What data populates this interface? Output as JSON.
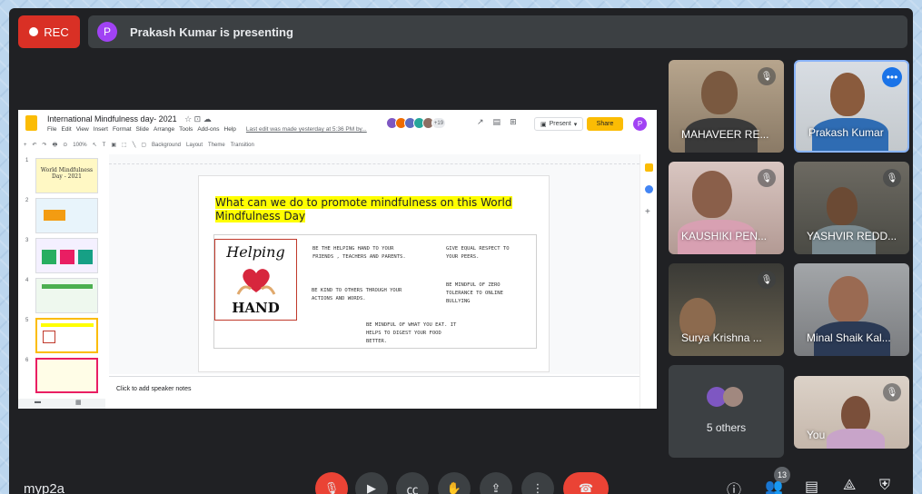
{
  "recording": {
    "label": "REC"
  },
  "presenter": {
    "avatar_letter": "P",
    "banner": "Prakash Kumar is presenting"
  },
  "slides_app": {
    "doc_title": "International Mindfulness day- 2021",
    "title_icons": "☆ ⊡ ☁",
    "menu": [
      "File",
      "Edit",
      "View",
      "Insert",
      "Format",
      "Slide",
      "Arrange",
      "Tools",
      "Add-ons",
      "Help"
    ],
    "last_edit": "Last edit was made yesterday at 5:36 PM by...",
    "collab_count": "+19",
    "present_label": "Present",
    "share_label": "Share",
    "user_letter": "P",
    "toolbar": [
      "+",
      "↶",
      "↷",
      "🖶",
      "⊙",
      "100%",
      "↖",
      "T",
      "▣",
      "⬚",
      "╲",
      "▢",
      "Background",
      "Layout",
      "Theme",
      "Transition"
    ],
    "thumbnails": [
      {
        "num": "1",
        "title": "World Mindfulness Day - 2021"
      },
      {
        "num": "2",
        "title": ""
      },
      {
        "num": "3",
        "title": ""
      },
      {
        "num": "4",
        "title": ""
      },
      {
        "num": "5",
        "title": ""
      },
      {
        "num": "6",
        "title": ""
      }
    ],
    "speaker_notes": "Click to add speaker notes",
    "current_slide": {
      "title": "What can we do to promote mindfulness on this World Mindfulness Day",
      "image_top": "Helping",
      "image_bottom": "HAND",
      "notes": [
        "Be the helping hand to your friends , teachers and parents.",
        "Give equal respect to your peers.",
        "Be kind to others through your actions and words.",
        "Be mindful of zero tolerance to online bullying",
        "Be mindful of what you eat. It helps to digest your food better."
      ]
    }
  },
  "participants": [
    {
      "name": "MAHAVEER RE...",
      "muted": true
    },
    {
      "name": "Prakash Kumar",
      "muted": false,
      "active": true
    },
    {
      "name": "KAUSHIKI PEN...",
      "muted": true
    },
    {
      "name": "YASHVIR REDD...",
      "muted": true
    },
    {
      "name": "Surya Krishna ...",
      "muted": true
    },
    {
      "name": "Minal Shaik Kal...",
      "muted": false
    },
    {
      "name": "5 others",
      "muted": false
    },
    {
      "name": "You",
      "muted": true
    }
  ],
  "bottom_bar": {
    "meeting_code": "myp2a",
    "people_count": "13"
  },
  "colors": {
    "rec": "#d93025",
    "end_call": "#ea4335",
    "accent": "#8ab4f8",
    "background": "#202124"
  }
}
